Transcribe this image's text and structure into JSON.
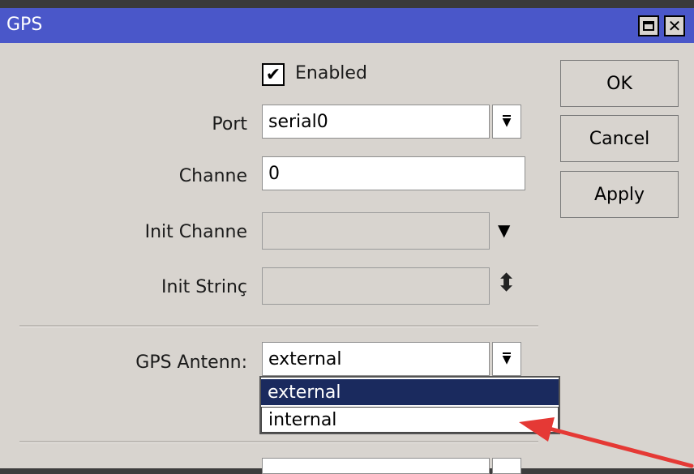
{
  "window": {
    "title": "GPS",
    "maximize_icon": "maximize-icon",
    "close_icon": "close-icon",
    "close_glyph": "✕"
  },
  "form": {
    "enabled": {
      "label": "Enabled",
      "checked": true,
      "check_glyph": "✔"
    },
    "port": {
      "label": "Port",
      "value": "serial0"
    },
    "channel": {
      "label": "Channe",
      "value": "0"
    },
    "init_channel": {
      "label": "Init Channe",
      "value": ""
    },
    "init_string": {
      "label": "Init Strinç",
      "value": ""
    },
    "gps_antenna": {
      "label": "GPS Antenn:",
      "value": "external",
      "options": [
        "external",
        "internal"
      ],
      "selected_index": 0
    }
  },
  "buttons": {
    "ok": "OK",
    "cancel": "Cancel",
    "apply": "Apply"
  },
  "glyphs": {
    "dropdown": "⯆",
    "dropdown_boxed": "▼",
    "spin": "⬍"
  },
  "colors": {
    "titlebar": "#4a57c9",
    "window_bg": "#d8d4cf",
    "selection": "#1a2a5e",
    "annotation_arrow": "#e53935"
  }
}
